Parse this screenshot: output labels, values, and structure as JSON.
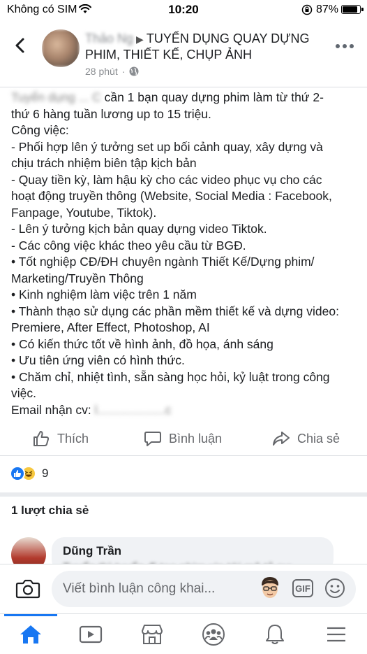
{
  "status_bar": {
    "carrier": "Không có SIM",
    "time": "10:20",
    "battery": "87%"
  },
  "header": {
    "title_blurred_prefix": "Thảo Ng",
    "title": "TUYỂN DỤNG QUAY DỰNG PHIM, THIẾT KẾ, CHỤP ẢNH",
    "time_ago": "28 phút"
  },
  "post": {
    "blurred_start": "Tuyển dụng ... C",
    "lines": [
      " cần 1 bạn quay dựng phim làm từ thứ 2-",
      "thứ 6 hàng tuần lương up to 15 triệu.",
      "Công việc:",
      "- Phối hợp lên ý tưởng set up bối cảnh quay, xây dựng và",
      "chịu trách nhiệm biên tập kịch bản",
      "- Quay tiền kỳ, làm hậu kỳ cho các video phục vụ cho các",
      "hoạt động truyền thông (Website, Social Media : Facebook,",
      "Fanpage, Youtube, Tiktok).",
      "- Lên ý tưởng kịch bản quay dựng video Tiktok.",
      "- Các công việc khác theo yêu cầu từ BGĐ.",
      "• Tốt nghiệp CĐ/ĐH chuyên ngành Thiết Kế/Dựng phim/",
      "Marketing/Truyền Thông",
      "• Kinh nghiệm làm việc trên 1 năm",
      "• Thành thạo sử dụng các phần mềm thiết kế và dựng video:",
      "Premiere, After Effect, Photoshop, AI",
      "• Có kiến thức tốt về hình ảnh, đồ họa, ánh sáng",
      "• Ưu tiên ứng viên có hình thức.",
      "• Chăm chỉ, nhiệt tình, sẵn sàng học hỏi, kỷ luật trong công",
      "việc."
    ],
    "email_label": "Email nhận cv: ",
    "email_blurred": "l....................c"
  },
  "actions": {
    "like": "Thích",
    "comment": "Bình luận",
    "share": "Chia sẻ"
  },
  "reactions": {
    "count": "9"
  },
  "shares": "1 lượt chia sẻ",
  "comment": {
    "author": "Dũng Trần",
    "text_blurred": "Tuyển thì tuyển đi tạo phim xin tới mê tỏ sự..."
  },
  "composer": {
    "placeholder": "Viết bình luận công khai...",
    "gif_label": "GIF"
  },
  "colors": {
    "accent": "#1877f2",
    "muted": "#65676b",
    "bubble": "#f0f2f5"
  }
}
